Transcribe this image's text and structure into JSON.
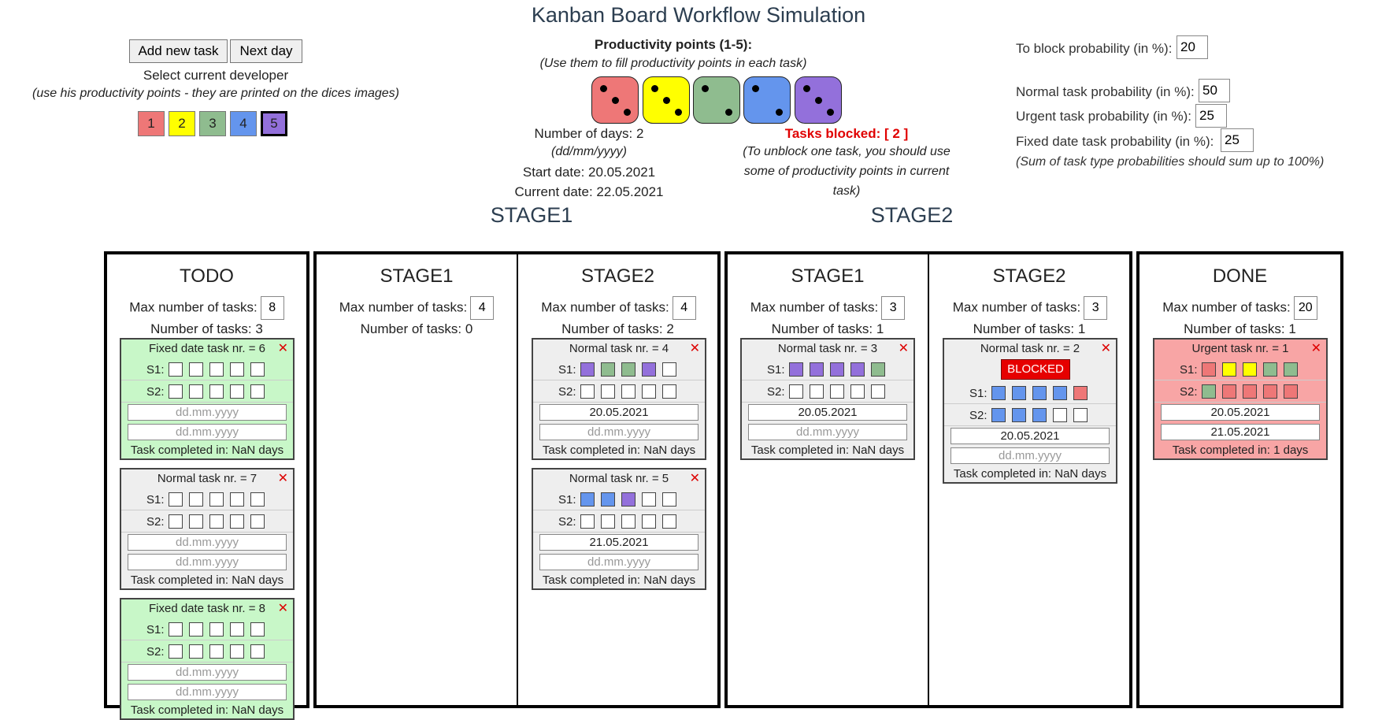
{
  "app": {
    "title": "Kanban Board Workflow Simulation"
  },
  "controls": {
    "add_task": "Add new task",
    "next_day": "Next day",
    "select_dev": "Select current developer",
    "select_dev_hint": "(use his productivity points - they are printed on the dices images)",
    "developers": [
      {
        "label": "1",
        "color": "#ee7777"
      },
      {
        "label": "2",
        "color": "#ffff00"
      },
      {
        "label": "3",
        "color": "#8fbc8f"
      },
      {
        "label": "4",
        "color": "#6495ed"
      },
      {
        "label": "5",
        "color": "#9370db"
      }
    ],
    "selected_developer": "5"
  },
  "productivity": {
    "title": "Productivity points (1-5):",
    "hint": "(Use them to fill productivity points in each task)",
    "dice": [
      {
        "pips": 3,
        "color": "#ee7777"
      },
      {
        "pips": 3,
        "color": "#ffff00"
      },
      {
        "pips": 2,
        "color": "#8fbc8f"
      },
      {
        "pips": 2,
        "color": "#6495ed"
      },
      {
        "pips": 3,
        "color": "#9370db"
      }
    ]
  },
  "info": {
    "days": "Number of days: 2",
    "date_format": "(dd/mm/yyyy)",
    "start_date": "Start date: 20.05.2021",
    "current_date": "Current date: 22.05.2021",
    "blocked_title": "Tasks blocked: [ 2 ]",
    "blocked_hint_1": "(To unblock one task, you should use",
    "blocked_hint_2": "some of productivity points in current",
    "blocked_hint_3": "task)"
  },
  "settings": {
    "block_label": "To block probability (in %):",
    "block_value": "20",
    "normal_label": "Normal task probability (in %):",
    "normal_value": "50",
    "urgent_label": "Urgent task probability (in %):",
    "urgent_value": "25",
    "fixed_label": "Fixed date task probability (in %):",
    "fixed_value": "25",
    "note": "(Sum of task type probabilities should sum up to 100%)"
  },
  "stage_headers": [
    "STAGE1",
    "STAGE2"
  ],
  "labels": {
    "max": "Max number of tasks:",
    "s1": "S1:",
    "s2": "S2:",
    "placeholder": "dd.mm.yyyy",
    "blocked": "BLOCKED"
  },
  "colors": {
    "dev1": "#ee7777",
    "dev2": "#ffff00",
    "dev3": "#8fbc8f",
    "dev4": "#6495ed",
    "dev5": "#9370db",
    "fixed_card": "#c8f7c8",
    "urgent_card": "#f8a5a5",
    "normal_card": "#eeeeee",
    "blocked": "#e60000"
  },
  "columns": [
    {
      "title": "TODO",
      "max": "8",
      "count": "Number of tasks: 3",
      "cards": [
        {
          "title": "Fixed date task nr. = 6",
          "type": "fixed",
          "s1": [
            0,
            0,
            0,
            0,
            0
          ],
          "s2": [
            0,
            0,
            0,
            0,
            0
          ],
          "start": "",
          "end": "",
          "completed": "Task completed in: NaN days",
          "blocked": false
        },
        {
          "title": "Normal task nr. = 7",
          "type": "normal",
          "s1": [
            0,
            0,
            0,
            0,
            0
          ],
          "s2": [
            0,
            0,
            0,
            0,
            0
          ],
          "start": "",
          "end": "",
          "completed": "Task completed in: NaN days",
          "blocked": false
        },
        {
          "title": "Fixed date task nr. = 8",
          "type": "fixed",
          "s1": [
            0,
            0,
            0,
            0,
            0
          ],
          "s2": [
            0,
            0,
            0,
            0,
            0
          ],
          "start": "",
          "end": "",
          "completed": "Task completed in: NaN days",
          "blocked": false
        }
      ]
    },
    {
      "title": "STAGE1",
      "max": "4",
      "count": "Number of tasks: 0",
      "cards": []
    },
    {
      "title": "STAGE2",
      "max": "4",
      "count": "Number of tasks: 2",
      "cards": [
        {
          "title": "Normal task nr. = 4",
          "type": "normal",
          "s1": [
            5,
            3,
            3,
            5,
            0
          ],
          "s2": [
            0,
            0,
            0,
            0,
            0
          ],
          "start": "20.05.2021",
          "end": "",
          "completed": "Task completed in: NaN days",
          "blocked": false
        },
        {
          "title": "Normal task nr. = 5",
          "type": "normal",
          "s1": [
            4,
            4,
            5,
            0,
            0
          ],
          "s2": [
            0,
            0,
            0,
            0,
            0
          ],
          "start": "21.05.2021",
          "end": "",
          "completed": "Task completed in: NaN days",
          "blocked": false
        }
      ]
    },
    {
      "title": "STAGE1",
      "max": "3",
      "count": "Number of tasks: 1",
      "cards": [
        {
          "title": "Normal task nr. = 3",
          "type": "normal",
          "s1": [
            5,
            5,
            5,
            5,
            3
          ],
          "s2": [
            0,
            0,
            0,
            0,
            0
          ],
          "start": "20.05.2021",
          "end": "",
          "completed": "Task completed in: NaN days",
          "blocked": false
        }
      ]
    },
    {
      "title": "STAGE2",
      "max": "3",
      "count": "Number of tasks: 1",
      "cards": [
        {
          "title": "Normal task nr. = 2",
          "type": "normal",
          "s1": [
            4,
            4,
            4,
            4,
            1
          ],
          "s2": [
            4,
            4,
            4,
            0,
            0
          ],
          "start": "20.05.2021",
          "end": "",
          "completed": "Task completed in: NaN days",
          "blocked": true
        }
      ]
    },
    {
      "title": "DONE",
      "max": "20",
      "count": "Number of tasks: 1",
      "cards": [
        {
          "title": "Urgent task nr. = 1",
          "type": "urgent",
          "s1": [
            1,
            2,
            2,
            3,
            3
          ],
          "s2": [
            3,
            1,
            1,
            1,
            1
          ],
          "start": "20.05.2021",
          "end": "21.05.2021",
          "completed": "Task completed in: 1 days",
          "blocked": false
        }
      ]
    }
  ]
}
